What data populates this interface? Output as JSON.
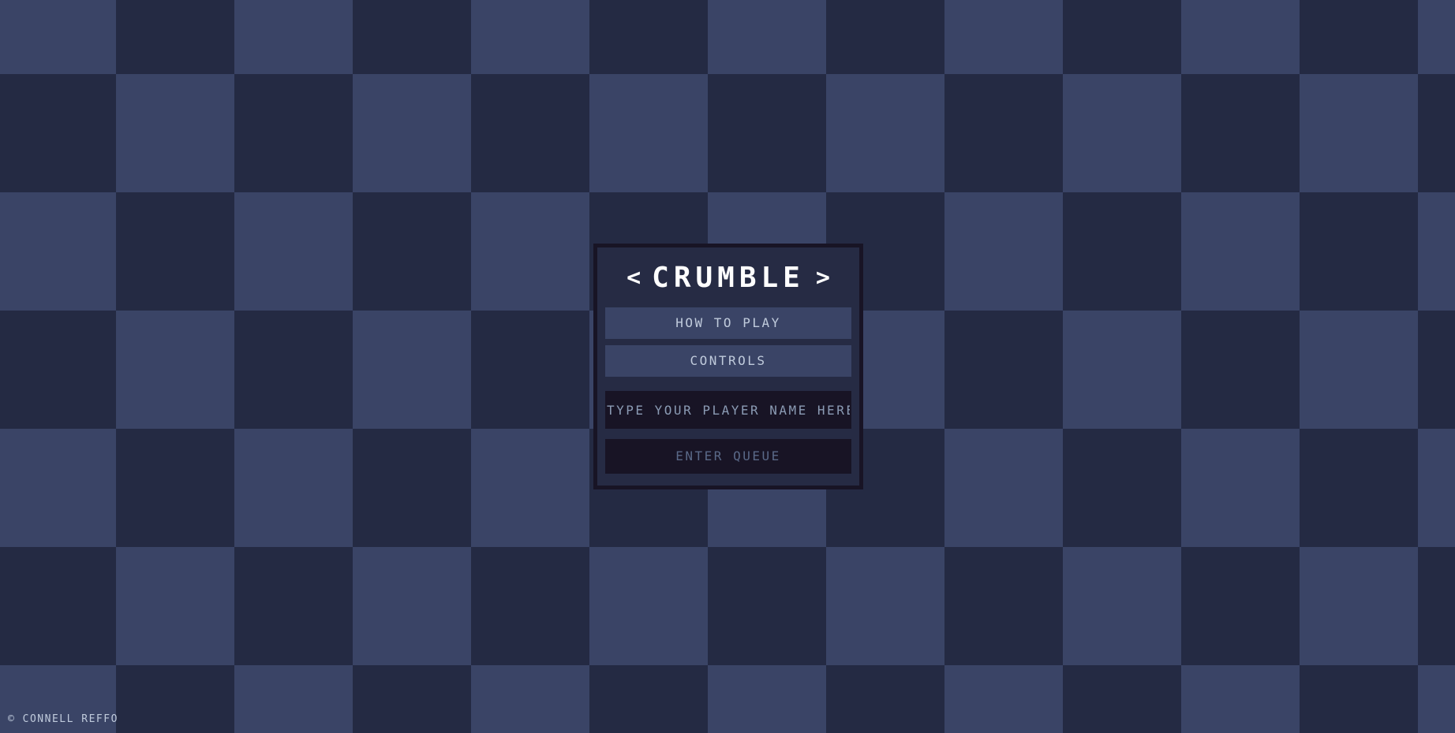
{
  "game": {
    "title": "CRUMBLE",
    "title_left_glyph": "<",
    "title_right_glyph": ">"
  },
  "menu": {
    "how_to_play_label": "HOW TO PLAY",
    "controls_label": "CONTROLS"
  },
  "player_name": {
    "value": "",
    "placeholder": "TYPE YOUR PLAYER NAME HERE"
  },
  "queue": {
    "enter_label": "ENTER QUEUE"
  },
  "footer": {
    "copyright": "© CONNELL REFFO"
  },
  "colors": {
    "board_dark": "#242a43",
    "board_light": "#3a4466",
    "panel_bg": "#262b44",
    "panel_border": "#181425",
    "button_bg": "#3a4466",
    "input_bg": "#181425",
    "text_primary": "#ffffff",
    "text_secondary": "#c0cbdc",
    "text_disabled": "#5a6988"
  }
}
